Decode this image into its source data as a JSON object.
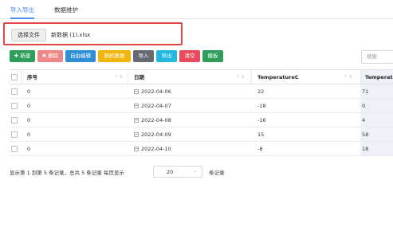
{
  "tabs": {
    "import_export": "导入导出",
    "data_maintenance": "数据维护"
  },
  "file": {
    "button_label": "选择文件",
    "file_name": "新数据 (1).xlsx"
  },
  "toolbar": {
    "new": "✚ 新建",
    "delete": "✖ 删除",
    "free_edit": "自由编辑",
    "random_data": "随机数据",
    "import": "导入",
    "export": "导出",
    "clear": "清空",
    "template": "模板"
  },
  "colors": {
    "new": "#2e9e5b",
    "delete": "#f08787",
    "free_edit": "#2f8fd6",
    "random_data": "#f0b60e",
    "import": "#666b73",
    "export": "#22b8e0",
    "clear": "#e84c5c",
    "template": "#2e9e5b"
  },
  "search": {
    "placeholder": "搜索"
  },
  "table": {
    "columns": [
      "序号",
      "日期",
      "TemperatureC",
      "Temperatu"
    ],
    "rows": [
      {
        "seq": "0",
        "date": "2022-04-06",
        "tempc": "22",
        "tempf": "71"
      },
      {
        "seq": "0",
        "date": "2022-04-07",
        "tempc": "-18",
        "tempf": "0"
      },
      {
        "seq": "0",
        "date": "2022-04-08",
        "tempc": "-16",
        "tempf": "4"
      },
      {
        "seq": "0",
        "date": "2022-04-09",
        "tempc": "15",
        "tempf": "58"
      },
      {
        "seq": "0",
        "date": "2022-04-10",
        "tempc": "-8",
        "tempf": "18"
      }
    ]
  },
  "pager": {
    "summary": "显示第 1 到第 5 条记录，总共 5 条记录 每页显示",
    "page_size": "20",
    "suffix": "条记录"
  }
}
